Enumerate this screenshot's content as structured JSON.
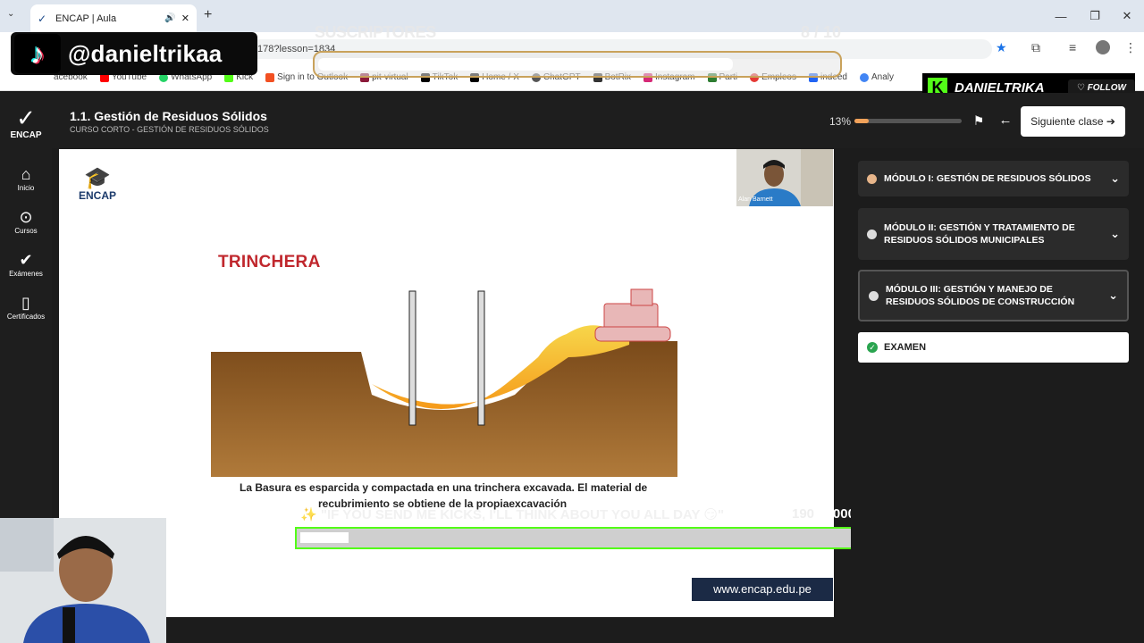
{
  "browser": {
    "tab_title": "ENCAP | Aula",
    "url": "/178?lesson=1834",
    "bookmarks": [
      "acebook",
      "YouTube",
      "WhatsApp",
      "Kick",
      "Sign in to Outlook",
      "pit-virtual",
      "TikTok",
      "Home / X",
      "ChatGPT",
      "BotRix",
      "Instagram",
      "Parti",
      "Empleos",
      "indeed",
      "Analy"
    ]
  },
  "overlays": {
    "tiktok_handle": "@danieltrikaa",
    "subs_label": "SUSCRIPTORES",
    "subs_count": "8 / 10",
    "subs_progress": 0.8,
    "kick_name": "DANIELTRIKA",
    "follow_label": "FOLLOW",
    "kicks_message": "\"IF YOU SEND ME KICKS, I'LL THINK ABOUT YOU ALL DAY 😏\"",
    "kicks_current": "190",
    "kicks_goal": "/ 2000",
    "kicks_progress": 0.095
  },
  "app": {
    "brand": "ENCAP",
    "nav": [
      {
        "label": "Inicio",
        "icon": "home-icon"
      },
      {
        "label": "Cursos",
        "icon": "play-icon"
      },
      {
        "label": "Exámenes",
        "icon": "check-icon"
      },
      {
        "label": "Certificados",
        "icon": "bookmark-icon"
      }
    ],
    "lesson_title": "1.1. Gestión de Residuos Sólidos",
    "lesson_subtitle": "CURSO CORTO - GESTIÓN DE RESIDUOS SÓLIDOS",
    "progress_text": "13%",
    "progress_value": 0.13,
    "next_button": "Siguiente clase ➔",
    "modules": [
      {
        "label": "MÓDULO I: GESTIÓN DE RESIDUOS SÓLIDOS",
        "status": "done"
      },
      {
        "label": "MÓDULO II: GESTIÓN Y TRATAMIENTO DE RESIDUOS SÓLIDOS MUNICIPALES",
        "status": "pending"
      },
      {
        "label": "MÓDULO III: GESTIÓN Y MANEJO DE RESIDUOS SÓLIDOS DE CONSTRUCCIÓN",
        "status": "pending"
      }
    ],
    "exam_label": "EXAMEN"
  },
  "slide": {
    "logo_text": "ENCAP",
    "heading": "TRINCHERA",
    "caption_line1": "La Basura es esparcida y compactada en una trinchera excavada. El material de",
    "caption_line2": "recubrimiento se obtiene de la propiaexcavación",
    "website": "www.encap.edu.pe",
    "presenter_name": "Alan Barnett"
  }
}
